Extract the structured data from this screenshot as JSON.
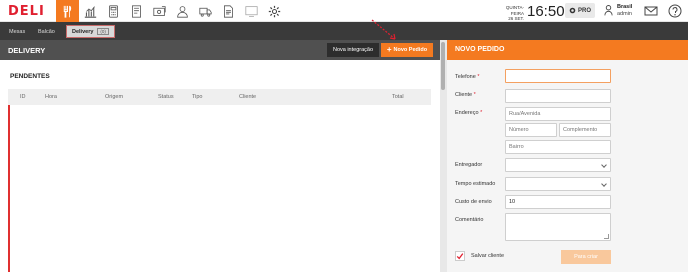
{
  "app": {
    "logo": "DELI"
  },
  "topbar": {
    "nav_icons": [
      "utensils-icon",
      "chart-icon",
      "calculator-icon",
      "menu-book-icon",
      "money-icon",
      "user-icon",
      "truck-icon",
      "document-icon",
      "tablet-icon",
      "gear-icon"
    ],
    "date_line1": "QUINTA-FEIRA",
    "date_line2": "26 SET.",
    "time": "16:50",
    "pro_label": "PRO",
    "user_name": "Brasil",
    "user_role": "admin"
  },
  "tabs": [
    {
      "label": "Mesas"
    },
    {
      "label": "Balcão"
    },
    {
      "label": "Delivery",
      "badge": "(0)"
    }
  ],
  "delivery": {
    "title": "DELIVERY",
    "integration_button": "Nova integração",
    "new_order_button": "Novo Pedido",
    "pending_title": "PENDENTES",
    "columns": [
      "ID",
      "Hora",
      "Origem",
      "Status",
      "Tipo",
      "Cliente",
      "Total"
    ]
  },
  "new_order": {
    "title": "NOVO PEDIDO",
    "phone_label": "Telefone",
    "client_label": "Cliente",
    "address_label": "Endereço",
    "street_placeholder": "Rua/Avenida",
    "number_placeholder": "Número",
    "complement_placeholder": "Complemento",
    "neighborhood_placeholder": "Bairro",
    "courier_label": "Entregador",
    "estimated_time_label": "Tempo estimado",
    "shipping_cost_label": "Custo de envio",
    "shipping_cost_value": "10",
    "comment_label": "Comentário",
    "save_client_label": "Salvar cliente",
    "save_client_checked": true,
    "save_button": "Para criar"
  },
  "colors": {
    "accent": "#f47a20",
    "required": "#e02030",
    "dark_bar": "#3a3a3a"
  }
}
